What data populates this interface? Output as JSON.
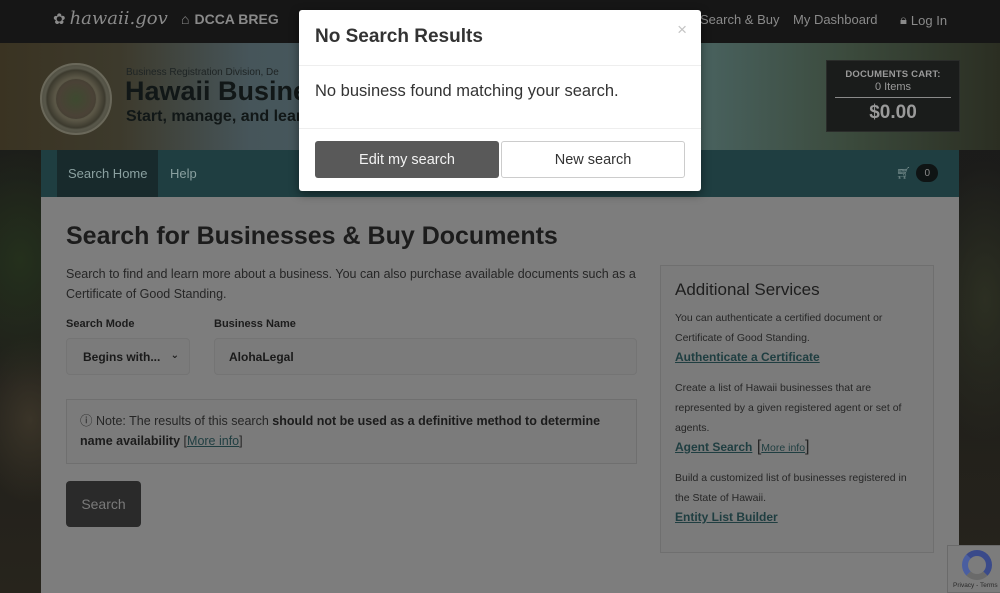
{
  "topnav": {
    "brand": "hawaii.gov",
    "brand_icon": "hibiscus-icon",
    "home_label": "DCCA BREG",
    "home_icon": "home-icon",
    "search_buy": "Search & Buy",
    "dashboard": "My Dashboard",
    "login": "Log In",
    "login_icon": "lock-icon"
  },
  "header": {
    "division": "Business Registration Division, De",
    "title": "Hawaii Busine",
    "subtitle": "Start, manage, and lear"
  },
  "cart": {
    "label": "DOCUMENTS CART:",
    "items": "0 Items",
    "total": "$0.00",
    "mini_count": "0"
  },
  "subnav": {
    "tabs": [
      {
        "label": "Search Home",
        "active": true
      },
      {
        "label": "Help",
        "active": false
      }
    ]
  },
  "main": {
    "title": "Search for Businesses & Buy Documents",
    "intro": "Search to find and learn more about a business. You can also purchase available documents such as a Certificate of Good Standing.",
    "search_mode_label": "Search Mode",
    "search_mode_value": "Begins with...",
    "business_name_label": "Business Name",
    "business_name_value": "AlohaLegal",
    "note_prefix": "Note: The results of this search ",
    "note_bold": "should not be used as a definitive method to determine name availability",
    "note_link": "More info",
    "search_button": "Search"
  },
  "aside": {
    "title": "Additional Services",
    "services": [
      {
        "text": "You can authenticate a certified document or Certificate of Good Standing.",
        "link": "Authenticate a Certificate"
      },
      {
        "text": "Create a list of Hawaii businesses that are represented by a given registered agent or set of agents.",
        "link": "Agent Search",
        "more": "More info"
      },
      {
        "text": "Build a customized list of businesses registered in the State of Hawaii.",
        "link": "Entity List Builder"
      }
    ]
  },
  "modal": {
    "title": "No Search Results",
    "close": "×",
    "message": "No business found matching your search.",
    "edit_button": "Edit my search",
    "new_button": "New search"
  },
  "recaptcha": {
    "links": "Privacy - Terms"
  }
}
